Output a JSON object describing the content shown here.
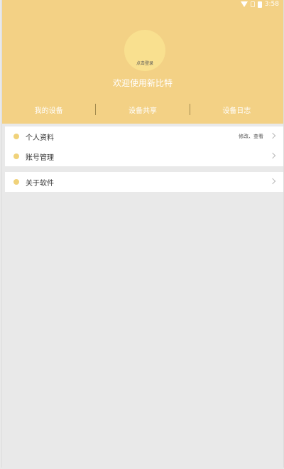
{
  "status_bar": {
    "time": "3:58"
  },
  "header": {
    "avatar_label": "点击登录",
    "welcome_text": "欢迎使用新比特",
    "tabs": [
      {
        "label": "我的设备"
      },
      {
        "label": "设备共享"
      },
      {
        "label": "设备日志"
      }
    ]
  },
  "menu": {
    "group1": [
      {
        "label": "个人资料",
        "hint": "修改、查看"
      },
      {
        "label": "账号管理"
      }
    ],
    "group2": [
      {
        "label": "关于软件"
      }
    ]
  },
  "colors": {
    "header_bg": "#f3d185",
    "avatar_bg": "#f9e08f",
    "page_bg": "#e9e9e9",
    "dot": "#f0d27a"
  },
  "icons": [
    "wifi-icon",
    "signal-icon",
    "battery-icon",
    "chevron-right-icon"
  ]
}
